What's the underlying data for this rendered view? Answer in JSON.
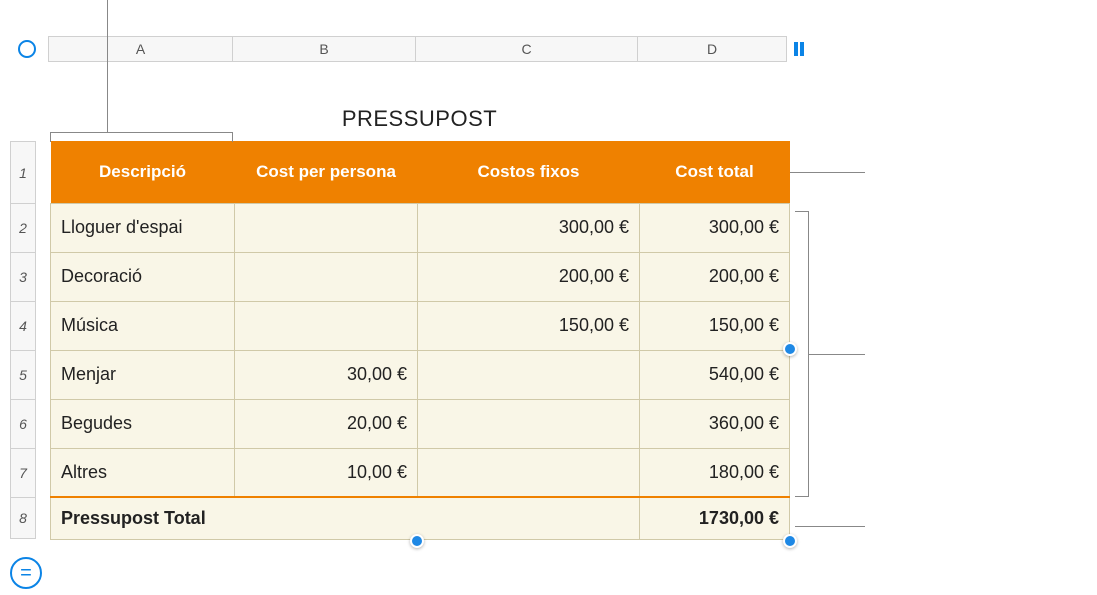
{
  "title": "PRESSUPOST",
  "columns": {
    "A": "A",
    "B": "B",
    "C": "C",
    "D": "D"
  },
  "rows": [
    "1",
    "2",
    "3",
    "4",
    "5",
    "6",
    "7",
    "8"
  ],
  "headers": {
    "desc": "Descripció",
    "cpp": "Cost per persona",
    "fixed": "Costos fixos",
    "total": "Cost total"
  },
  "body": [
    {
      "desc": "Lloguer d'espai",
      "cpp": "",
      "fixed": "300,00 €",
      "total": "300,00 €"
    },
    {
      "desc": "Decoració",
      "cpp": "",
      "fixed": "200,00 €",
      "total": "200,00 €"
    },
    {
      "desc": "Música",
      "cpp": "",
      "fixed": "150,00 €",
      "total": "150,00 €"
    },
    {
      "desc": "Menjar",
      "cpp": "30,00 €",
      "fixed": "",
      "total": "540,00 €"
    },
    {
      "desc": "Begudes",
      "cpp": "20,00 €",
      "fixed": "",
      "total": "360,00 €"
    },
    {
      "desc": "Altres",
      "cpp": "10,00 €",
      "fixed": "",
      "total": "180,00 €"
    }
  ],
  "footer": {
    "label": "Pressupost Total",
    "value": "1730,00 €"
  },
  "controls": {
    "equals": "="
  }
}
